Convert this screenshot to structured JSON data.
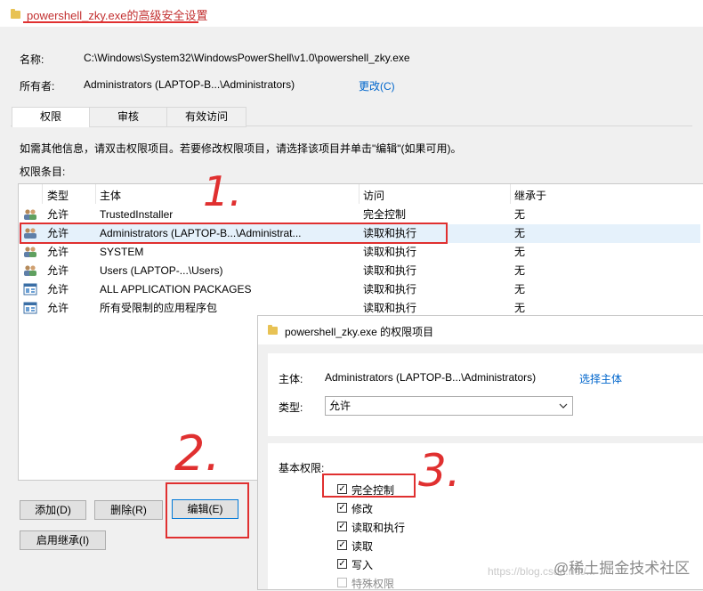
{
  "window": {
    "title": "powershell_zky.exe的高级安全设置"
  },
  "info": {
    "name_label": "名称:",
    "name_value": "C:\\Windows\\System32\\WindowsPowerShell\\v1.0\\powershell_zky.exe",
    "owner_label": "所有者:",
    "owner_value": "Administrators (LAPTOP-B...\\Administrators)",
    "change_link": "更改(C)"
  },
  "tabs": [
    {
      "label": "权限"
    },
    {
      "label": "审核"
    },
    {
      "label": "有效访问"
    }
  ],
  "instructions": "如需其他信息，请双击权限项目。若要修改权限项目，请选择该项目并单击\"编辑\"(如果可用)。",
  "entries_label": "权限条目:",
  "table": {
    "headers": [
      "类型",
      "主体",
      "访问",
      "继承于"
    ],
    "rows": [
      {
        "type": "允许",
        "principal": "TrustedInstaller",
        "access": "完全控制",
        "inherited": "无",
        "icon": "users-icon"
      },
      {
        "type": "允许",
        "principal": "Administrators (LAPTOP-B...\\Administrat...",
        "access": "读取和执行",
        "inherited": "无",
        "icon": "users-icon"
      },
      {
        "type": "允许",
        "principal": "SYSTEM",
        "access": "读取和执行",
        "inherited": "无",
        "icon": "users-icon"
      },
      {
        "type": "允许",
        "principal": "Users (LAPTOP-...\\Users)",
        "access": "读取和执行",
        "inherited": "无",
        "icon": "users-icon"
      },
      {
        "type": "允许",
        "principal": "ALL APPLICATION PACKAGES",
        "access": "读取和执行",
        "inherited": "无",
        "icon": "app-package-icon"
      },
      {
        "type": "允许",
        "principal": "所有受限制的应用程序包",
        "access": "读取和执行",
        "inherited": "无",
        "icon": "app-package-icon"
      }
    ]
  },
  "buttons": {
    "add": "添加(D)",
    "remove": "删除(R)",
    "edit": "编辑(E)",
    "inherit": "启用继承(I)"
  },
  "annotations": {
    "one": "1.",
    "two": "2.",
    "three": "3."
  },
  "dialog": {
    "title": "powershell_zky.exe 的权限项目",
    "principal_label": "主体:",
    "principal_value": "Administrators (LAPTOP-B...\\Administrators)",
    "select_principal": "选择主体",
    "type_label": "类型:",
    "type_value": "允许",
    "basic_label": "基本权限:",
    "permissions": [
      {
        "label": "完全控制",
        "checked": true,
        "disabled": false
      },
      {
        "label": "修改",
        "checked": true,
        "disabled": false
      },
      {
        "label": "读取和执行",
        "checked": true,
        "disabled": false
      },
      {
        "label": "读取",
        "checked": true,
        "disabled": false
      },
      {
        "label": "写入",
        "checked": true,
        "disabled": false
      },
      {
        "label": "特殊权限",
        "checked": false,
        "disabled": true
      }
    ]
  },
  "watermark": {
    "url": "https://blog.csdn.net/...",
    "site": "@稀土掘金技术社区"
  }
}
